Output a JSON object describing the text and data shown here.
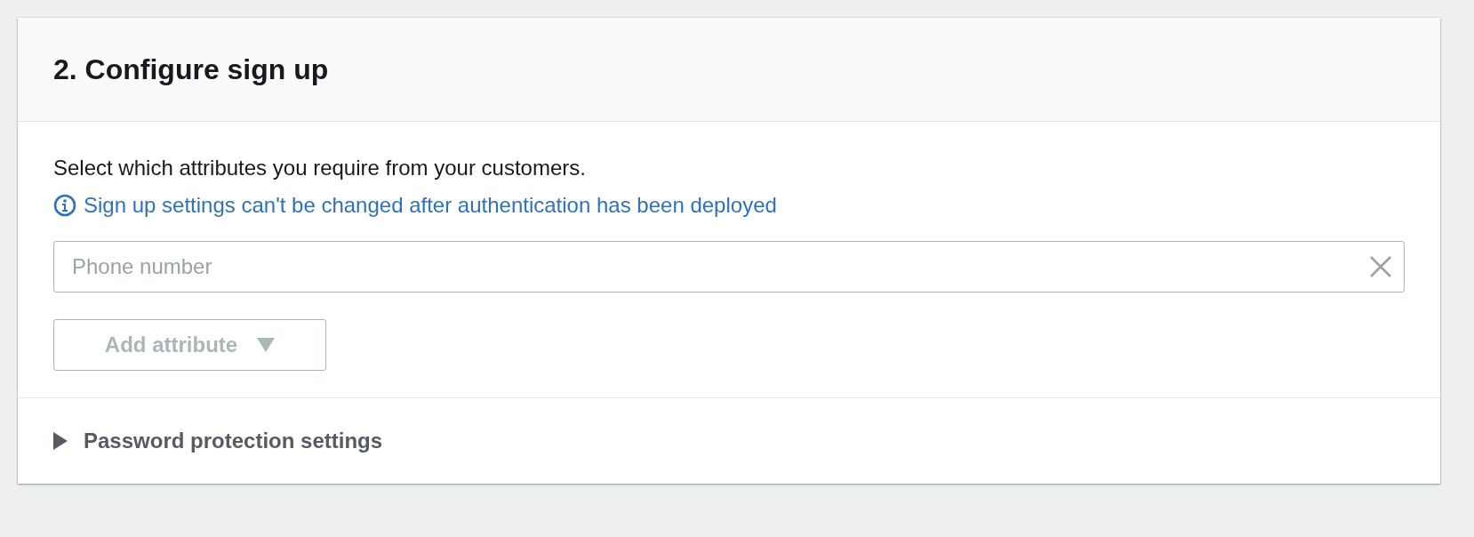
{
  "section": {
    "title": "2. Configure sign up"
  },
  "description": "Select which attributes you require from your customers.",
  "info_note": "Sign up settings can't be changed after authentication has been deployed",
  "attributes": [
    {
      "value": "Phone number",
      "disabled": true
    }
  ],
  "add_button": {
    "label": "Add attribute",
    "disabled": true
  },
  "expander": {
    "label": "Password protection settings",
    "expanded": false
  }
}
